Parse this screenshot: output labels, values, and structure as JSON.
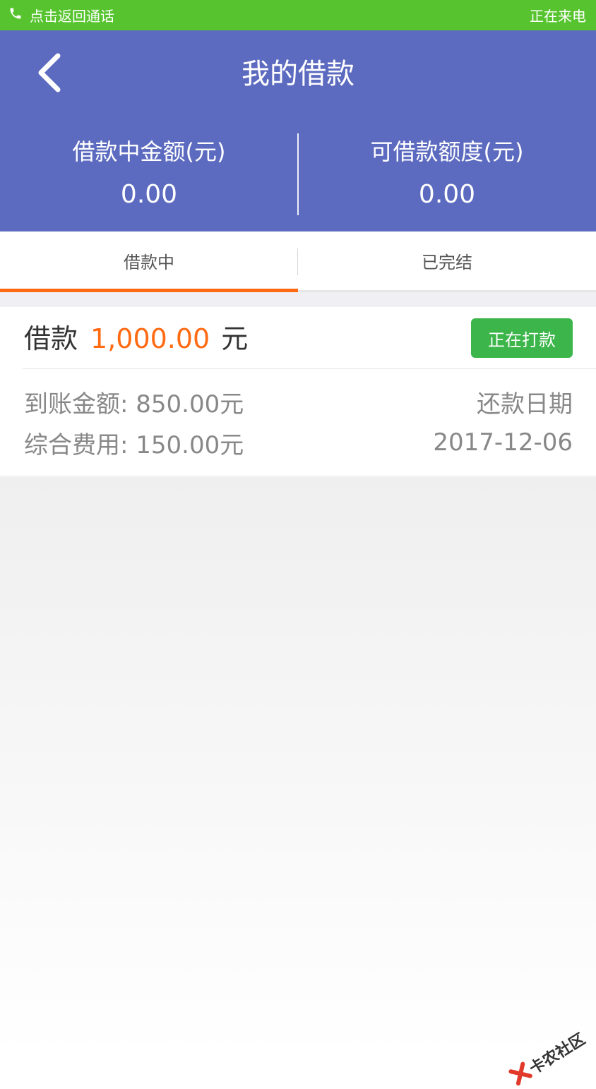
{
  "status_bar": {
    "return_call_text": "点击返回通话",
    "incoming_text": "正在来电"
  },
  "header": {
    "title": "我的借款",
    "stats": [
      {
        "label": "借款中金额(元)",
        "value": "0.00"
      },
      {
        "label": "可借款额度(元)",
        "value": "0.00"
      }
    ]
  },
  "tabs": [
    {
      "label": "借款中",
      "active": true
    },
    {
      "label": "已完结",
      "active": false
    }
  ],
  "loan": {
    "prefix": "借款",
    "amount": "1,000.00",
    "unit": "元",
    "status": "正在打款",
    "received_label": "到账金额:",
    "received_value": "850.00元",
    "fee_label": "综合费用:",
    "fee_value": "150.00元",
    "repay_label": "还款日期",
    "repay_date": "2017-12-06"
  },
  "watermark": {
    "text": "卡农社区"
  },
  "colors": {
    "call_bar": "#57c42f",
    "header": "#5c6bc0",
    "accent": "#ff6a13",
    "status_button": "#3cb54a"
  }
}
